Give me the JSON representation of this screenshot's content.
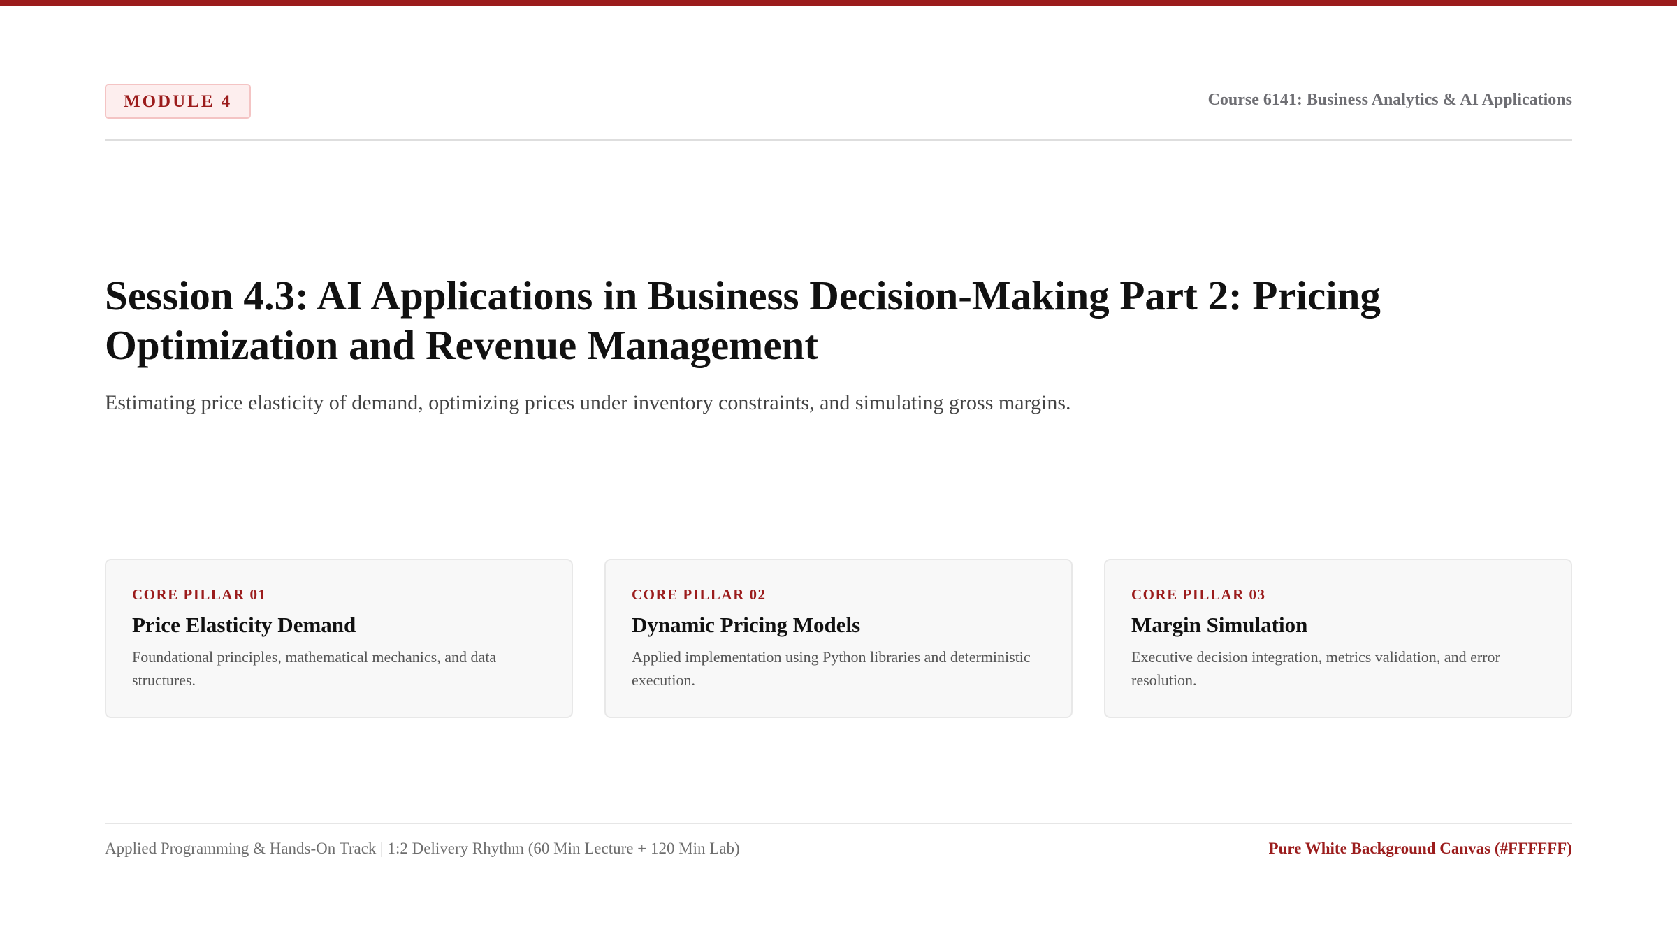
{
  "header": {
    "module_badge": "MODULE 4",
    "course_title": "Course 6141: Business Analytics & AI Applications"
  },
  "session": {
    "title": "Session 4.3: AI Applications in Business Decision-Making Part 2: Pricing Optimization and Revenue Management",
    "subtitle": "Estimating price elasticity of demand, optimizing prices under inventory constraints, and simulating gross margins."
  },
  "pillars": [
    {
      "tag": "CORE PILLAR 01",
      "heading": "Price Elasticity Demand",
      "description": "Foundational principles, mathematical mechanics, and data structures."
    },
    {
      "tag": "CORE PILLAR 02",
      "heading": "Dynamic Pricing Models",
      "description": "Applied implementation using Python libraries and deterministic execution."
    },
    {
      "tag": "CORE PILLAR 03",
      "heading": "Margin Simulation",
      "description": "Executive decision integration, metrics validation, and error resolution."
    }
  ],
  "footer": {
    "left_text": "Applied Programming & Hands-On Track | 1:2 Delivery Rhythm (60 Min Lecture + 120 Min Lab)",
    "right_text": "Pure White Background Canvas (#FFFFFF)"
  },
  "colors": {
    "accent": "#9b1c1c",
    "background": "#ffffff",
    "badge_background": "#fdeeee",
    "card_background": "#f8f8f8"
  }
}
